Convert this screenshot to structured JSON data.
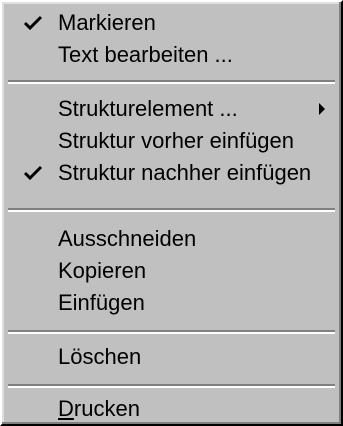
{
  "menu": {
    "items": [
      {
        "label": "Markieren",
        "checked": true
      },
      {
        "label": "Text bearbeiten ..."
      },
      {
        "label": "Strukturelement ...",
        "submenu": true
      },
      {
        "label": "Struktur vorher einfügen"
      },
      {
        "label": "Struktur nachher einfügen",
        "checked": true
      },
      {
        "label": "Ausschneiden"
      },
      {
        "label": "Kopieren"
      },
      {
        "label": "Einfügen"
      },
      {
        "label": "Löschen"
      },
      {
        "label": "Drucken",
        "mnemonic_first": "D",
        "mnemonic_rest": "rucken"
      }
    ]
  },
  "icons": {
    "check": "check-mark-icon",
    "submenu_arrow": "submenu-arrow-icon"
  },
  "colors": {
    "menu_bg": "#c0c0c0",
    "text": "#000000",
    "separator_dark": "#808080",
    "separator_light": "#ffffff"
  }
}
